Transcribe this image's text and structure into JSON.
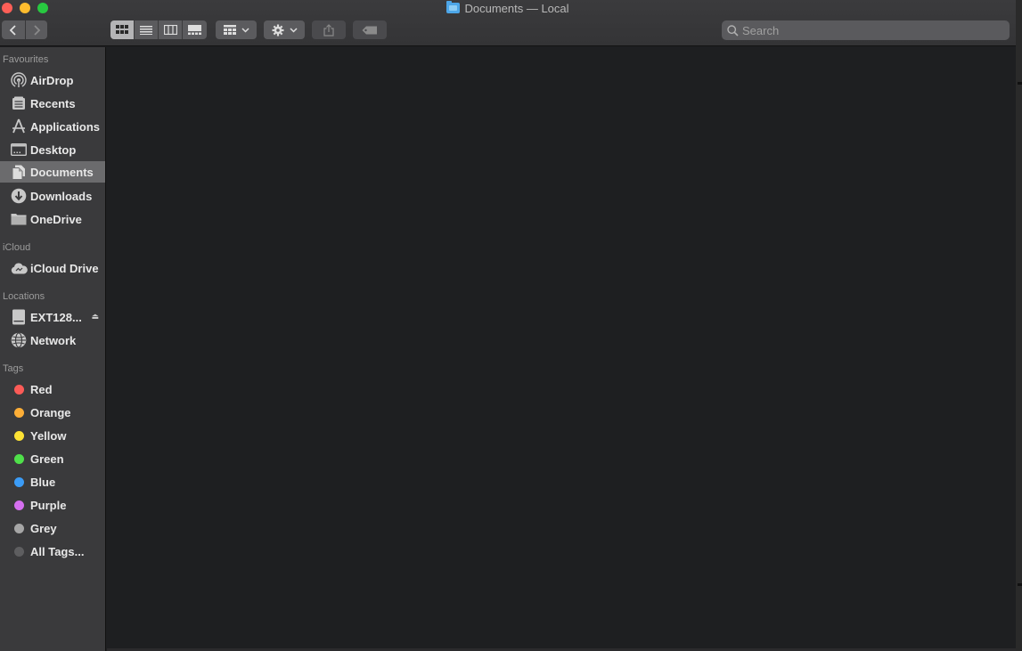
{
  "window": {
    "title": "Documents — Local"
  },
  "toolbar": {
    "back_icon": "chevron-left-icon",
    "forward_icon": "chevron-right-icon",
    "views": [
      "icon-view-icon",
      "list-view-icon",
      "column-view-icon",
      "gallery-view-icon"
    ],
    "group_icon": "group-by-icon",
    "action_icon": "gear-icon",
    "share_icon": "share-icon",
    "tag_icon": "tag-icon"
  },
  "search": {
    "placeholder": "Search",
    "value": ""
  },
  "sidebar": {
    "favourites_header": "Favourites",
    "favourites": [
      {
        "label": "AirDrop",
        "icon": "airdrop-icon"
      },
      {
        "label": "Recents",
        "icon": "recents-icon"
      },
      {
        "label": "Applications",
        "icon": "applications-icon"
      },
      {
        "label": "Desktop",
        "icon": "desktop-icon"
      },
      {
        "label": "Documents",
        "icon": "documents-icon",
        "selected": true
      },
      {
        "label": "Downloads",
        "icon": "downloads-icon"
      },
      {
        "label": "OneDrive",
        "icon": "folder-icon"
      }
    ],
    "icloud_header": "iCloud",
    "icloud": [
      {
        "label": "iCloud Drive",
        "icon": "icloud-icon"
      }
    ],
    "locations_header": "Locations",
    "locations": [
      {
        "label": "EXT128...",
        "icon": "drive-icon",
        "eject": "⏏"
      },
      {
        "label": "Network",
        "icon": "network-icon"
      }
    ],
    "tags_header": "Tags",
    "tags": [
      {
        "label": "Red",
        "color": "#fc5b57"
      },
      {
        "label": "Orange",
        "color": "#fdae37"
      },
      {
        "label": "Yellow",
        "color": "#fde234"
      },
      {
        "label": "Green",
        "color": "#4fe04a"
      },
      {
        "label": "Blue",
        "color": "#3b9cf7"
      },
      {
        "label": "Purple",
        "color": "#d56ff0"
      },
      {
        "label": "Grey",
        "color": "#a6a6a6"
      },
      {
        "label": "All Tags...",
        "color": "#5e5e60"
      }
    ]
  }
}
